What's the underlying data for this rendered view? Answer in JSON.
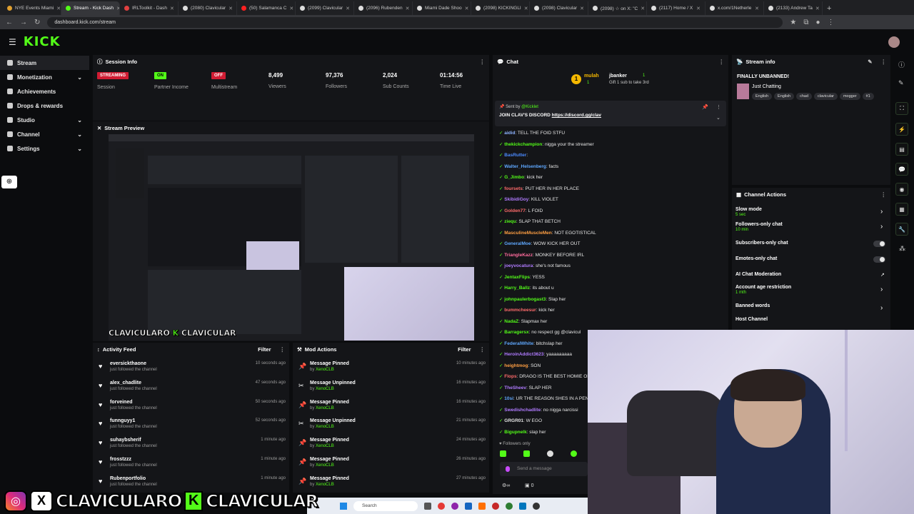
{
  "browser": {
    "tabs": [
      {
        "label": "NYE Events Miami",
        "color": "#e0a030"
      },
      {
        "label": "Stream - Kick Dash",
        "color": "#53fc18",
        "active": true
      },
      {
        "label": "IRLToolkit - Dash",
        "color": "#e04040"
      },
      {
        "label": "(2080) Clavicular",
        "color": "#dddddd"
      },
      {
        "label": "(50) Salamanca C",
        "color": "#ff2020"
      },
      {
        "label": "(2099) Clavicular",
        "color": "#dddddd"
      },
      {
        "label": "(2096) Rubenden",
        "color": "#dddddd"
      },
      {
        "label": "Miami Dade Shoo",
        "color": "#dddddd"
      },
      {
        "label": "(2098) KICKINGLI",
        "color": "#dddddd"
      },
      {
        "label": "(2098) Clavicular",
        "color": "#dddddd"
      },
      {
        "label": "(2098) ☆ on X: \"C",
        "color": "#dddddd"
      },
      {
        "label": "(2117) Home / X",
        "color": "#dddddd"
      },
      {
        "label": "x.com/1Netherle",
        "color": "#dddddd"
      },
      {
        "label": "(2133) Andrew Ta",
        "color": "#dddddd"
      }
    ],
    "url": "dashboard.kick.com/stream"
  },
  "kick": {
    "logo": "KICK"
  },
  "sidebar": {
    "items": [
      {
        "label": "Stream",
        "icon": "broadcast-icon",
        "active": true,
        "chev": ""
      },
      {
        "label": "Monetization",
        "icon": "dollar-icon",
        "chev": "⌄"
      },
      {
        "label": "Achievements",
        "icon": "trophy-icon",
        "chev": ""
      },
      {
        "label": "Drops & rewards",
        "icon": "gift-icon",
        "chev": ""
      },
      {
        "label": "Studio",
        "icon": "studio-icon",
        "chev": "⌄"
      },
      {
        "label": "Channel",
        "icon": "channel-icon",
        "chev": "⌄"
      },
      {
        "label": "Settings",
        "icon": "gear-icon",
        "chev": "⌄"
      }
    ]
  },
  "session": {
    "title": "Session Info",
    "streaming": "STREAMING",
    "session_label": "Session",
    "on": "ON",
    "partner_label": "Partner Income",
    "off": "OFF",
    "multi_label": "Multistream",
    "viewers": "8,499",
    "viewers_label": "Viewers",
    "followers": "97,376",
    "followers_label": "Followers",
    "subs": "2,024",
    "subs_label": "Sub Counts",
    "time": "01:14:56",
    "time_label": "Time Live"
  },
  "preview": {
    "title": "Stream Preview",
    "overlay": "CLAVICULARO",
    "overlay2": "CLAVICULAR"
  },
  "activity": {
    "title": "Activity Feed",
    "filter": "Filter",
    "rows": [
      {
        "name": "eversickthaone",
        "sub": "just followed the channel",
        "time": "10 seconds ago"
      },
      {
        "name": "alex_chadlite",
        "sub": "just followed the channel",
        "time": "47 seconds ago"
      },
      {
        "name": "forveined",
        "sub": "just followed the channel",
        "time": "50 seconds ago"
      },
      {
        "name": "funnguyy1",
        "sub": "just followed the channel",
        "time": "52 seconds ago"
      },
      {
        "name": "suhaybsherif",
        "sub": "just followed the channel",
        "time": "1 minute ago"
      },
      {
        "name": "frosstzzz",
        "sub": "just followed the channel",
        "time": "1 minute ago"
      },
      {
        "name": "Rubenportfolio",
        "sub": "just followed the channel",
        "time": "1 minute ago"
      }
    ]
  },
  "mod": {
    "title": "Mod Actions",
    "filter": "Filter",
    "rows": [
      {
        "name": "Message Pinned",
        "by": "by",
        "who": "XenoCLB",
        "time": "10 minutes ago"
      },
      {
        "name": "Message Unpinned",
        "by": "by",
        "who": "XenoCLB",
        "time": "16 minutes ago"
      },
      {
        "name": "Message Pinned",
        "by": "by",
        "who": "XenoCLB",
        "time": "16 minutes ago"
      },
      {
        "name": "Message Unpinned",
        "by": "by",
        "who": "XenoCLB",
        "time": "21 minutes ago"
      },
      {
        "name": "Message Pinned",
        "by": "by",
        "who": "XenoCLB",
        "time": "24 minutes ago"
      },
      {
        "name": "Message Pinned",
        "by": "by",
        "who": "XenoCLB",
        "time": "26 minutes ago"
      },
      {
        "name": "Message Pinned",
        "by": "by",
        "who": "XenoCLB",
        "time": "27 minutes ago"
      }
    ]
  },
  "chat": {
    "title": "Chat",
    "top1": "mulah",
    "top1_count": "1",
    "top2": "jbanker",
    "top2_count": "1",
    "gift": "Gift 1 sub to take 3rd",
    "pinned_by": "Sent by",
    "pinned_user": "@Kicklet",
    "pinned_text": "JOIN CLAV'S DISCORD ",
    "pinned_link": "https://discord.gg/clav",
    "messages": [
      {
        "u": "aidid",
        "t": ": TELL THE FOID STFU",
        "c": "#8fb4ff"
      },
      {
        "u": "thekickchampion",
        "t": ": nigga your the streamer",
        "c": "#53fc18"
      },
      {
        "u": "BasRutter",
        "t": ":",
        "c": "#4b8bff"
      },
      {
        "u": "Walter_Helsenberg",
        "t": ": facts",
        "c": "#5fa8ff"
      },
      {
        "u": "G_Jimbo",
        "t": ": kick her",
        "c": "#53fc18"
      },
      {
        "u": "foursets",
        "t": ": PUT HER IN HER PLACE",
        "c": "#ff6b6b"
      },
      {
        "u": "SkibidiGoy",
        "t": ": KILL VIOLET",
        "c": "#b07bff"
      },
      {
        "u": "Golden77",
        "t": ": L FOID",
        "c": "#ff6b6b"
      },
      {
        "u": "ziequ",
        "t": ": SLAP THAT BETCH",
        "c": "#53fc18"
      },
      {
        "u": "MasculineMuscleMen",
        "t": ": NOT EGOTISTICAL",
        "c": "#ff9f43"
      },
      {
        "u": "GeneralMoe",
        "t": ": WOW KICK HER OUT",
        "c": "#5fa8ff"
      },
      {
        "u": "TriangleKazz",
        "t": ": MONKEY BEFORE IRL",
        "c": "#ff6b9d"
      },
      {
        "u": "joeyvocatura",
        "t": ": she's not famous",
        "c": "#b07bff"
      },
      {
        "u": "JentaxFlips",
        "t": ": YESS",
        "c": "#53fc18"
      },
      {
        "u": "Harry_Ballz",
        "t": ": its about u",
        "c": "#53fc18"
      },
      {
        "u": "johnpaulerbogast3",
        "t": ": Slap her",
        "c": "#53fc18"
      },
      {
        "u": "bummcheesur",
        "t": ": kick her",
        "c": "#ff6b6b"
      },
      {
        "u": "NadaZ",
        "t": ": Slapmax her",
        "c": "#53fc18"
      },
      {
        "u": "Barragersx",
        "t": ": no respect gg @clavicul",
        "c": "#53fc18"
      },
      {
        "u": "FederalWhite",
        "t": ": bitchslap her",
        "c": "#5fa8ff"
      },
      {
        "u": "HeroinAddict3623",
        "t": ": yaaaaaaaaa",
        "c": "#b07bff"
      },
      {
        "u": "heightmog",
        "t": ": SON",
        "c": "#ff9f43"
      },
      {
        "u": "Flops",
        "t": ": DRAGO IS THE BEST HOMIE ON S",
        "c": "#ff6b6b"
      },
      {
        "u": "TheSheev",
        "t": ": SLAP HER",
        "c": "#b07bff"
      },
      {
        "u": "10si",
        "t": ": UR THE REASON SHES IN A PENTI",
        "c": "#5fa8ff"
      },
      {
        "u": "Swedishchadlite",
        "t": ": no nigga narcissi",
        "c": "#b07bff"
      },
      {
        "u": "GRGR01",
        "t": ": W EGO",
        "c": "#e6e6e6"
      },
      {
        "u": "Bigupnelk",
        "t": ": slap her",
        "c": "#53fc18"
      }
    ],
    "followers_only": "Followers only",
    "placeholder": "Send a message",
    "count": "0"
  },
  "stream_info": {
    "title": "Stream info",
    "stream_title": "FINALLY UNBANNED!",
    "category": "Just Chatting",
    "tags": [
      "English",
      "English",
      "chad",
      "clavicular",
      "mogger",
      "#1"
    ]
  },
  "channel_actions": {
    "title": "Channel Actions",
    "items": [
      {
        "label": "Slow mode",
        "sub": "5 sec",
        "ctrl": "arrow"
      },
      {
        "label": "Followers-only chat",
        "sub": "10 min",
        "ctrl": "arrow"
      },
      {
        "label": "Subscribers-only chat",
        "sub": "",
        "ctrl": "toggle"
      },
      {
        "label": "Emotes-only chat",
        "sub": "",
        "ctrl": "toggle"
      },
      {
        "label": "AI Chat Moderation",
        "sub": "",
        "ctrl": "ext"
      },
      {
        "label": "Account age restriction",
        "sub": "1 mth",
        "ctrl": "arrow"
      },
      {
        "label": "Banned words",
        "sub": "",
        "ctrl": "arrow"
      },
      {
        "label": "Host Channel",
        "sub": "",
        "ctrl": ""
      }
    ]
  },
  "taskbar": {
    "search": "Search"
  },
  "overlay": {
    "name1": "CLAVICULARO",
    "name2": "CLAVICULAR"
  }
}
